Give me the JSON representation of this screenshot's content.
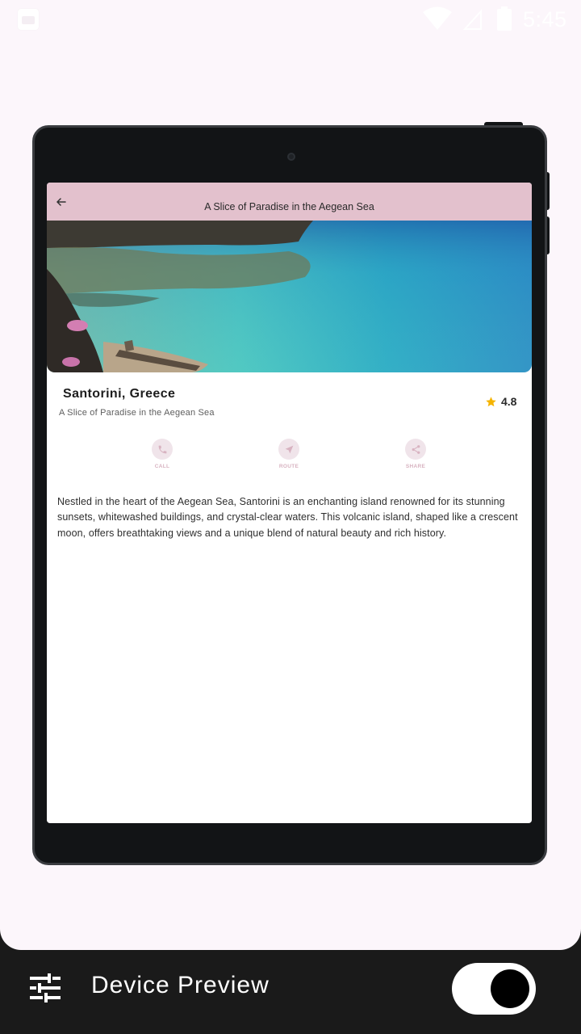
{
  "status_bar": {
    "time": "5:45",
    "icons": [
      "app-notification-icon",
      "wifi-icon",
      "signal-icon",
      "battery-icon"
    ]
  },
  "app_bar": {
    "title": "A Slice of Paradise in the Aegean Sea",
    "back_icon": "arrow-left-icon"
  },
  "place": {
    "name": "Santorini, Greece",
    "subtitle": "A Slice of Paradise in the Aegean Sea",
    "rating": "4.8",
    "rating_icon": "star-icon",
    "rating_color": "#f5b400"
  },
  "actions": [
    {
      "label": "CALL",
      "icon": "phone-icon"
    },
    {
      "label": "ROUTE",
      "icon": "navigation-icon"
    },
    {
      "label": "SHARE",
      "icon": "share-icon"
    }
  ],
  "description": "Nestled in the heart of the Aegean Sea, Santorini is an enchanting island renowned for its stunning sunsets, whitewashed buildings, and crystal-clear waters. This volcanic island, shaped like a crescent moon, offers breathtaking views and a unique blend of natural beauty and rich history.",
  "bottom_bar": {
    "title": "Device Preview",
    "tune_icon": "tune-icon",
    "toggle_on": true
  },
  "colors": {
    "app_bar": "#e3c1cd",
    "action_circle": "#f0e4ea",
    "action_label": "#d8b3c1",
    "screen_bg": "#fcf6fb",
    "frame": "#121416"
  }
}
